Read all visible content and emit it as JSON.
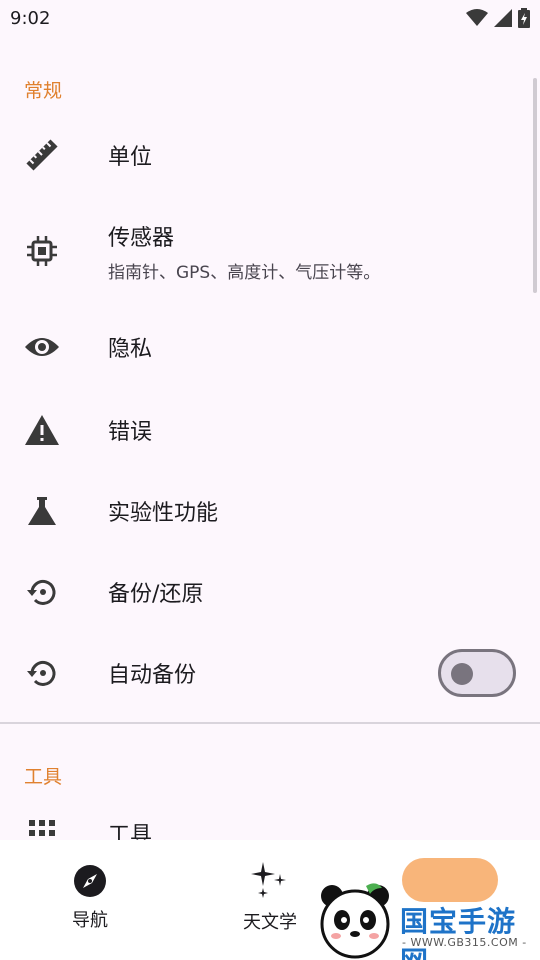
{
  "status_bar": {
    "time": "9:02"
  },
  "sections": [
    {
      "header": "常规"
    },
    {
      "header": "工具"
    }
  ],
  "items": {
    "units": {
      "title": "单位",
      "icon": "ruler-icon"
    },
    "sensors": {
      "title": "传感器",
      "subtitle": "指南针、GPS、高度计、气压计等。",
      "icon": "chip-icon"
    },
    "privacy": {
      "title": "隐私",
      "icon": "eye-icon"
    },
    "errors": {
      "title": "错误",
      "icon": "warning-icon"
    },
    "experimental": {
      "title": "实验性功能",
      "icon": "flask-icon"
    },
    "backup_restore": {
      "title": "备份/还原",
      "icon": "restore-icon"
    },
    "auto_backup": {
      "title": "自动备份",
      "icon": "restore-icon",
      "enabled": false
    },
    "tools": {
      "title": "工具",
      "icon": "grid-icon"
    }
  },
  "bottom_nav": {
    "items": [
      {
        "label": "导航",
        "icon": "compass-icon"
      },
      {
        "label": "天文学",
        "icon": "sparkle-icon"
      }
    ]
  },
  "watermark": {
    "text": "国宝手游网",
    "url": "- WWW.GB315.COM -"
  },
  "colors": {
    "accent": "#e0812f",
    "background": "#fdf7fd"
  }
}
